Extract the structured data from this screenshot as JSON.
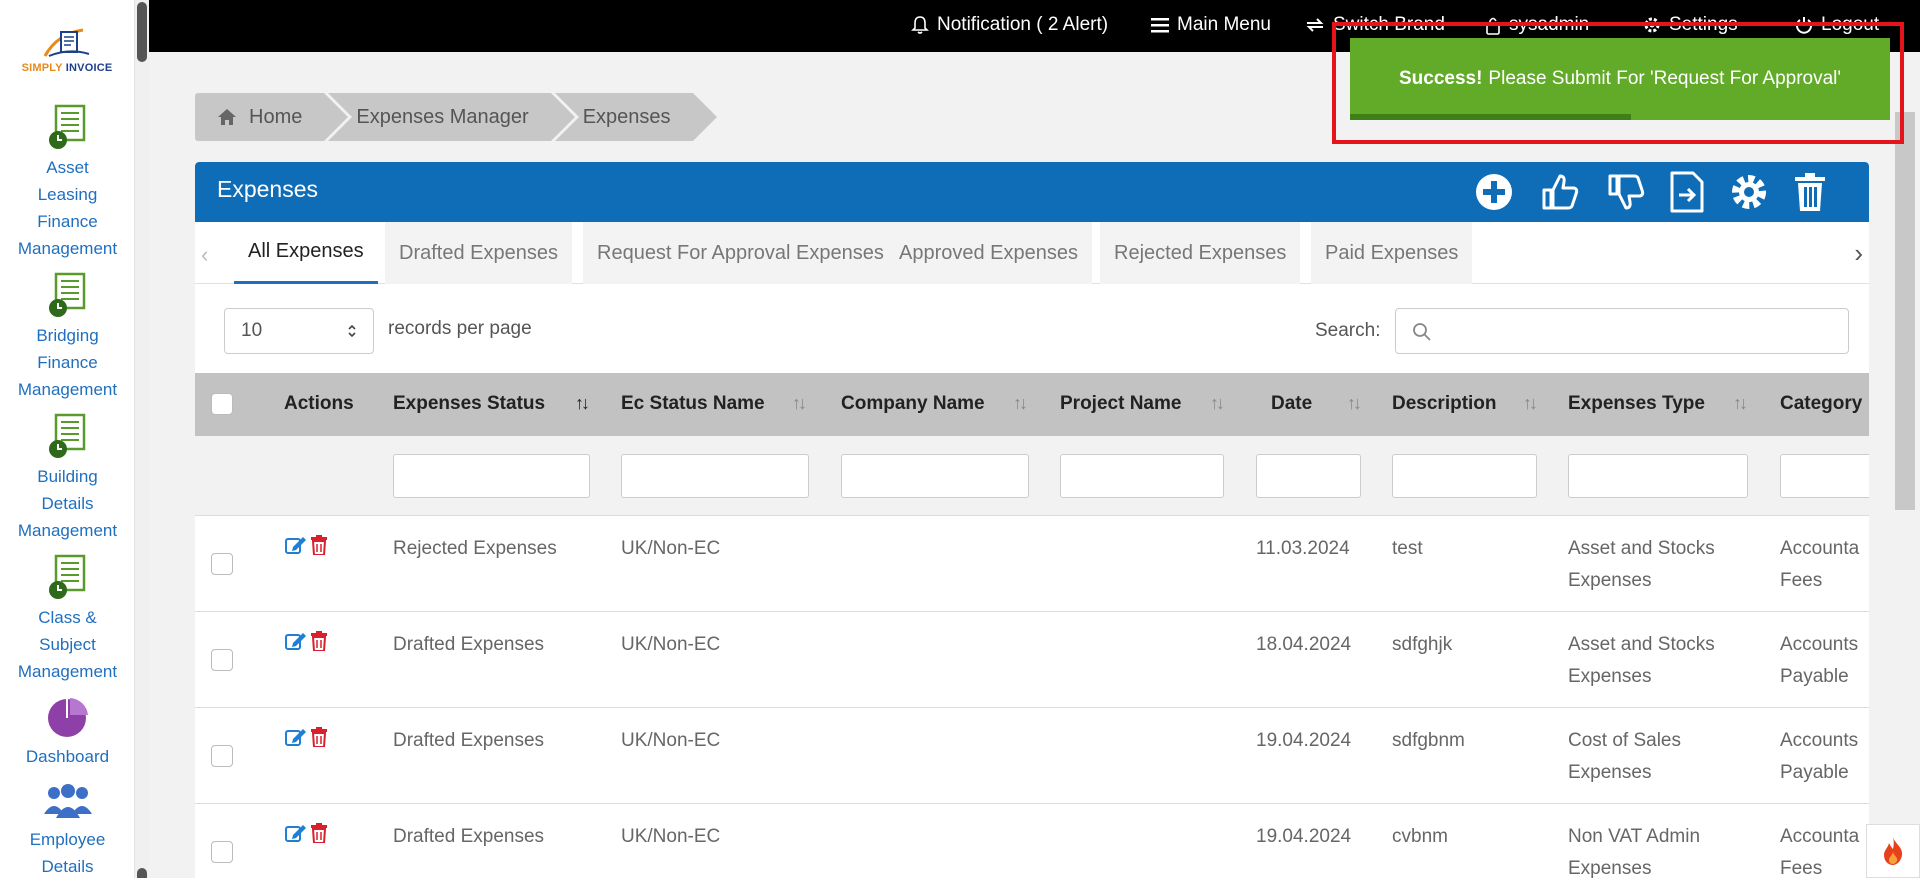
{
  "logo": {
    "text_part1": "SIMPLY",
    "text_part2": "INVOICE"
  },
  "sidebar": {
    "items": [
      {
        "label_lines": [
          "Asset",
          "Leasing",
          "Finance",
          "Management"
        ],
        "icon": "ledger-clock-icon"
      },
      {
        "label_lines": [
          "Bridging",
          "Finance",
          "Management"
        ],
        "icon": "ledger-clock-icon"
      },
      {
        "label_lines": [
          "Building",
          "Details",
          "Management"
        ],
        "icon": "ledger-clock-icon"
      },
      {
        "label_lines": [
          "Class &",
          "Subject",
          "Management"
        ],
        "icon": "ledger-clock-icon"
      },
      {
        "label_lines": [
          "Dashboard"
        ],
        "icon": "pie-chart-icon"
      },
      {
        "label_lines": [
          "Employee",
          "Details"
        ],
        "icon": "users-group-icon"
      }
    ]
  },
  "topbar": {
    "notification": "Notification ( 2 Alert)",
    "main_menu": "Main Menu",
    "switch_brand": "Switch Brand",
    "user": "sysadmin",
    "settings": "Settings",
    "logout": "Logout"
  },
  "breadcrumb": [
    "Home",
    "Expenses Manager",
    "Expenses"
  ],
  "panel": {
    "title": "Expenses",
    "tools": [
      "add-icon",
      "thumbs-up-icon",
      "thumbs-down-icon",
      "export-icon",
      "gear-icon",
      "trash-icon"
    ]
  },
  "tabs": [
    "All Expenses",
    "Drafted Expenses",
    "Request For Approval Expenses",
    "Approved Expenses",
    "Rejected Expenses",
    "Paid Expenses"
  ],
  "table_controls": {
    "page_length": "10",
    "page_length_label": "records per page",
    "search_label": "Search:",
    "search_value": ""
  },
  "table": {
    "headers": [
      "Actions",
      "Expenses Status",
      "Ec Status Name",
      "Company Name",
      "Project Name",
      "Date",
      "Description",
      "Expenses Type",
      "Category"
    ],
    "rows": [
      {
        "status": "Rejected Expenses",
        "ec_status": "UK/Non-EC",
        "company": "",
        "project": "",
        "date": "11.03.2024",
        "description": "test",
        "type_l1": "Asset and Stocks",
        "type_l2": "Expenses",
        "cat_l1": "Accounta",
        "cat_l2": "Fees"
      },
      {
        "status": "Drafted Expenses",
        "ec_status": "UK/Non-EC",
        "company": "",
        "project": "",
        "date": "18.04.2024",
        "description": "sdfghjk",
        "type_l1": "Asset and Stocks",
        "type_l2": "Expenses",
        "cat_l1": "Accounts",
        "cat_l2": "Payable"
      },
      {
        "status": "Drafted Expenses",
        "ec_status": "UK/Non-EC",
        "company": "",
        "project": "",
        "date": "19.04.2024",
        "description": "sdfgbnm",
        "type_l1": "Cost of Sales",
        "type_l2": "Expenses",
        "cat_l1": "Accounts",
        "cat_l2": "Payable"
      },
      {
        "status": "Drafted Expenses",
        "ec_status": "UK/Non-EC",
        "company": "",
        "project": "",
        "date": "19.04.2024",
        "description": "cvbnm",
        "type_l1": "Non VAT Admin",
        "type_l2": "Expenses",
        "cat_l1": "Accounta",
        "cat_l2": "Fees"
      }
    ]
  },
  "toast": {
    "strong": "Success!",
    "message": "Please Submit For 'Request For Approval'",
    "progress": 0.52
  },
  "colors": {
    "brand_blue": "#0f6db8",
    "success_green": "#62ab29",
    "highlight_red": "#e4141a",
    "edit_blue": "#1f7fd6",
    "delete_red": "#d9212e"
  }
}
